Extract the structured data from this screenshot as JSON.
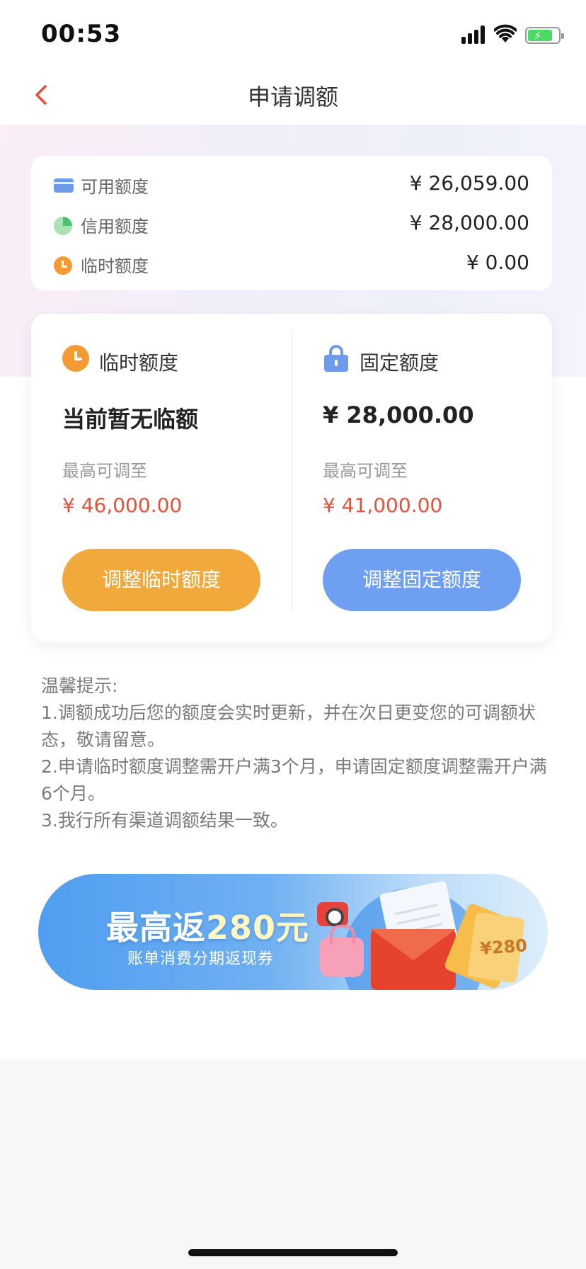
{
  "status_bar": {
    "time": "00:53"
  },
  "nav": {
    "title": "申请调额"
  },
  "summary": {
    "rows": [
      {
        "label": "可用额度",
        "value": "¥ 26,059.00",
        "icon": "card-icon"
      },
      {
        "label": "信用额度",
        "value": "¥ 28,000.00",
        "icon": "pie-icon"
      },
      {
        "label": "临时额度",
        "value": "¥ 0.00",
        "icon": "clock-icon"
      }
    ]
  },
  "adjust": {
    "temporary": {
      "title": "临时额度",
      "current": "当前暂无临额",
      "max_label": "最高可调至",
      "max_value": "¥ 46,000.00",
      "button": "调整临时额度"
    },
    "fixed": {
      "title": "固定额度",
      "current": "¥ 28,000.00",
      "max_label": "最高可调至",
      "max_value": "¥ 41,000.00",
      "button": "调整固定额度"
    }
  },
  "tips": {
    "title": "温馨提示:",
    "items": [
      "1.调额成功后您的额度会实时更新，并在次日更变您的可调额状态，敬请留意。",
      "2.申请临时额度调整需开户满3个月，申请固定额度调整需开户满6个月。",
      "3.我行所有渠道调额结果一致。"
    ]
  },
  "banner": {
    "title_prefix": "最高返",
    "title_accent": "280元",
    "subtitle": "账单消费分期返现券",
    "coupon_text": "¥280"
  },
  "colors": {
    "accent_red": "#e55239",
    "temp_button": "#f1a93c",
    "fixed_button": "#6f9ff0"
  }
}
